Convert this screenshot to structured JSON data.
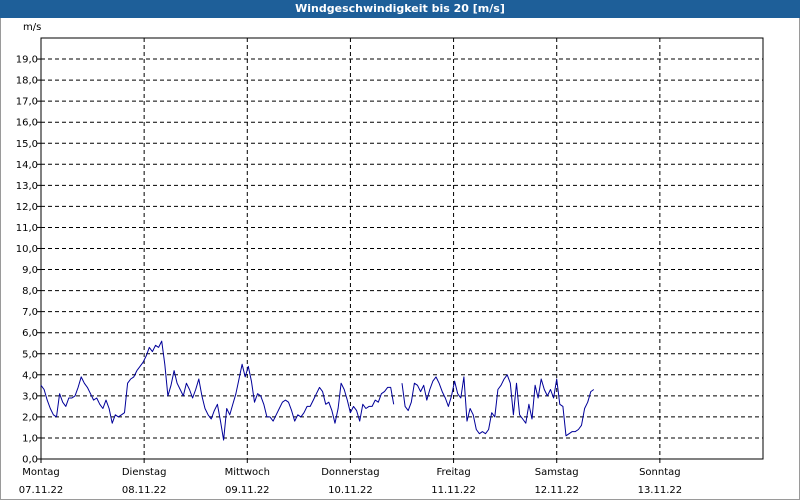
{
  "window": {
    "title": "Windgeschwindigkeit bis 20 [m/s]",
    "title_bg": "#1e5f99"
  },
  "chart_data": {
    "type": "line",
    "title": "Windgeschwindigkeit bis 20 [m/s]",
    "unit_label": "m/s",
    "ylim": [
      0,
      20
    ],
    "y_ticks": [
      "0,0",
      "1,0",
      "2,0",
      "3,0",
      "4,0",
      "5,0",
      "6,0",
      "7,0",
      "8,0",
      "9,0",
      "10,0",
      "11,0",
      "12,0",
      "13,0",
      "14,0",
      "15,0",
      "16,0",
      "17,0",
      "18,0",
      "19,0"
    ],
    "x_days": [
      {
        "day": "Montag",
        "date": "07.11.22"
      },
      {
        "day": "Dienstag",
        "date": "08.11.22"
      },
      {
        "day": "Mittwoch",
        "date": "09.11.22"
      },
      {
        "day": "Donnerstag",
        "date": "10.11.22"
      },
      {
        "day": "Freitag",
        "date": "11.11.22"
      },
      {
        "day": "Samstag",
        "date": "12.11.22"
      },
      {
        "day": "Sonntag",
        "date": "13.11.22"
      }
    ],
    "x_range_days": [
      0,
      7
    ],
    "grid": true,
    "line_color": "#000099",
    "series": [
      {
        "values": [
          [
            0.0,
            3.5
          ],
          [
            0.03,
            3.3
          ],
          [
            0.06,
            2.8
          ],
          [
            0.09,
            2.4
          ],
          [
            0.12,
            2.1
          ],
          [
            0.15,
            2.0
          ],
          [
            0.18,
            3.1
          ],
          [
            0.21,
            2.7
          ],
          [
            0.24,
            2.5
          ],
          [
            0.27,
            2.9
          ],
          [
            0.3,
            2.9
          ],
          [
            0.33,
            3.0
          ],
          [
            0.36,
            3.4
          ],
          [
            0.39,
            3.9
          ],
          [
            0.42,
            3.6
          ],
          [
            0.45,
            3.4
          ],
          [
            0.48,
            3.1
          ],
          [
            0.51,
            2.8
          ],
          [
            0.54,
            2.9
          ],
          [
            0.57,
            2.6
          ],
          [
            0.6,
            2.4
          ],
          [
            0.63,
            2.8
          ],
          [
            0.66,
            2.4
          ],
          [
            0.69,
            1.7
          ],
          [
            0.72,
            2.1
          ],
          [
            0.75,
            2.0
          ],
          [
            0.78,
            2.1
          ],
          [
            0.81,
            2.2
          ],
          [
            0.84,
            3.6
          ],
          [
            0.87,
            3.8
          ],
          [
            0.9,
            3.9
          ],
          [
            0.93,
            4.2
          ],
          [
            0.96,
            4.4
          ],
          [
            0.99,
            4.6
          ],
          [
            1.02,
            4.9
          ],
          [
            1.05,
            5.3
          ],
          [
            1.08,
            5.1
          ],
          [
            1.11,
            5.4
          ],
          [
            1.14,
            5.3
          ],
          [
            1.17,
            5.6
          ],
          [
            1.2,
            4.5
          ],
          [
            1.23,
            3.0
          ],
          [
            1.26,
            3.5
          ],
          [
            1.29,
            4.2
          ],
          [
            1.32,
            3.6
          ],
          [
            1.35,
            3.3
          ],
          [
            1.38,
            3.0
          ],
          [
            1.41,
            3.6
          ],
          [
            1.44,
            3.3
          ],
          [
            1.47,
            2.9
          ],
          [
            1.5,
            3.3
          ],
          [
            1.53,
            3.8
          ],
          [
            1.56,
            3.0
          ],
          [
            1.59,
            2.4
          ],
          [
            1.62,
            2.1
          ],
          [
            1.65,
            1.9
          ],
          [
            1.68,
            2.3
          ],
          [
            1.71,
            2.6
          ],
          [
            1.74,
            1.8
          ],
          [
            1.77,
            0.9
          ],
          [
            1.8,
            2.4
          ],
          [
            1.83,
            2.1
          ],
          [
            1.86,
            2.6
          ],
          [
            1.89,
            3.1
          ],
          [
            1.92,
            3.8
          ],
          [
            1.95,
            4.5
          ],
          [
            1.98,
            3.9
          ],
          [
            2.01,
            4.4
          ],
          [
            2.04,
            3.7
          ],
          [
            2.07,
            2.7
          ],
          [
            2.1,
            3.1
          ],
          [
            2.13,
            3.0
          ],
          [
            2.16,
            2.6
          ],
          [
            2.19,
            2.0
          ],
          [
            2.22,
            2.0
          ],
          [
            2.25,
            1.8
          ],
          [
            2.28,
            2.1
          ],
          [
            2.31,
            2.4
          ],
          [
            2.34,
            2.7
          ],
          [
            2.37,
            2.8
          ],
          [
            2.4,
            2.7
          ],
          [
            2.43,
            2.3
          ],
          [
            2.46,
            1.8
          ],
          [
            2.49,
            2.1
          ],
          [
            2.52,
            2.0
          ],
          [
            2.55,
            2.2
          ],
          [
            2.58,
            2.5
          ],
          [
            2.61,
            2.5
          ],
          [
            2.64,
            2.8
          ],
          [
            2.67,
            3.1
          ],
          [
            2.7,
            3.4
          ],
          [
            2.73,
            3.2
          ],
          [
            2.76,
            2.6
          ],
          [
            2.79,
            2.7
          ],
          [
            2.82,
            2.3
          ],
          [
            2.85,
            1.7
          ],
          [
            2.88,
            2.4
          ],
          [
            2.91,
            3.6
          ],
          [
            2.94,
            3.3
          ],
          [
            2.97,
            2.8
          ],
          [
            3.0,
            2.2
          ],
          [
            3.03,
            2.5
          ],
          [
            3.06,
            2.3
          ],
          [
            3.09,
            1.8
          ],
          [
            3.12,
            2.6
          ],
          [
            3.15,
            2.4
          ],
          [
            3.18,
            2.5
          ],
          [
            3.21,
            2.5
          ],
          [
            3.24,
            2.8
          ],
          [
            3.27,
            2.7
          ],
          [
            3.3,
            3.1
          ],
          [
            3.33,
            3.2
          ],
          [
            3.36,
            3.4
          ],
          [
            3.39,
            3.4
          ],
          [
            3.42,
            2.6
          ]
        ]
      },
      {
        "values": [
          [
            3.5,
            3.6
          ],
          [
            3.53,
            2.5
          ],
          [
            3.56,
            2.3
          ],
          [
            3.59,
            2.7
          ],
          [
            3.62,
            3.6
          ],
          [
            3.65,
            3.5
          ],
          [
            3.68,
            3.2
          ],
          [
            3.71,
            3.5
          ],
          [
            3.74,
            2.8
          ],
          [
            3.77,
            3.3
          ],
          [
            3.8,
            3.7
          ],
          [
            3.83,
            3.9
          ],
          [
            3.86,
            3.6
          ],
          [
            3.89,
            3.2
          ],
          [
            3.92,
            2.9
          ],
          [
            3.95,
            2.5
          ],
          [
            3.98,
            3.0
          ],
          [
            4.01,
            3.7
          ],
          [
            4.04,
            3.1
          ],
          [
            4.07,
            2.9
          ],
          [
            4.1,
            3.9
          ],
          [
            4.13,
            1.8
          ],
          [
            4.16,
            2.4
          ],
          [
            4.19,
            2.1
          ],
          [
            4.22,
            1.4
          ],
          [
            4.25,
            1.2
          ],
          [
            4.28,
            1.3
          ],
          [
            4.31,
            1.2
          ],
          [
            4.34,
            1.4
          ],
          [
            4.37,
            2.2
          ],
          [
            4.4,
            2.0
          ],
          [
            4.43,
            3.3
          ],
          [
            4.46,
            3.5
          ],
          [
            4.49,
            3.8
          ],
          [
            4.52,
            4.0
          ],
          [
            4.55,
            3.6
          ],
          [
            4.58,
            2.1
          ],
          [
            4.61,
            3.6
          ],
          [
            4.64,
            2.1
          ],
          [
            4.67,
            1.9
          ],
          [
            4.7,
            1.7
          ],
          [
            4.73,
            2.6
          ],
          [
            4.76,
            1.9
          ],
          [
            4.79,
            3.5
          ],
          [
            4.82,
            2.9
          ],
          [
            4.85,
            3.8
          ],
          [
            4.88,
            3.3
          ],
          [
            4.91,
            3.0
          ],
          [
            4.94,
            3.3
          ],
          [
            4.97,
            2.9
          ],
          [
            5.0,
            3.8
          ],
          [
            5.03,
            2.6
          ],
          [
            5.06,
            2.5
          ],
          [
            5.09,
            1.1
          ],
          [
            5.12,
            1.2
          ],
          [
            5.15,
            1.3
          ],
          [
            5.18,
            1.3
          ],
          [
            5.21,
            1.4
          ],
          [
            5.24,
            1.6
          ],
          [
            5.27,
            2.4
          ],
          [
            5.3,
            2.7
          ],
          [
            5.33,
            3.2
          ],
          [
            5.36,
            3.3
          ]
        ]
      }
    ]
  }
}
